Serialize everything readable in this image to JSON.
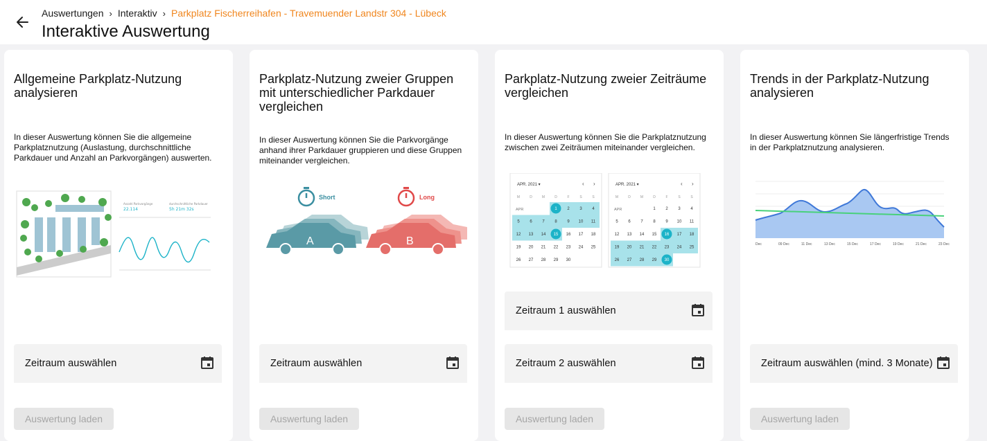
{
  "header": {
    "breadcrumb": [
      "Auswertungen",
      "Interaktiv",
      "Parkplatz Fischerreihafen - Travemuender Landstr 304 - Lübeck"
    ],
    "title": "Interaktive Auswertung"
  },
  "colors": {
    "accent": "#f0861e",
    "teal": "#1cb3c8",
    "car_a": "#5a9aa6",
    "car_b": "#e46e6a"
  },
  "cards": [
    {
      "title": "Allgemeine Parkplatz-Nutzung analysieren",
      "description": "In dieser Auswertung können Sie die allgemeine Parkplatznutzung (Auslastung, durchschnittliche Parkdauer und Anzahl an Parkvorgängen) auswerten.",
      "fields": [
        "Zeitraum auswählen"
      ],
      "button": "Auswertung laden",
      "illustration": {
        "stat1_label": "Anzahl Parkvorgänge",
        "stat1_value": "22.114",
        "stat2_label": "durchschnittliche Parkdauer",
        "stat2_value": "5h 21m 32s"
      }
    },
    {
      "title": "Parkplatz-Nutzung zweier Gruppen mit unterschiedlicher Parkdauer vergleichen",
      "description": "In dieser Auswertung können Sie die Parkvorgänge anhand ihrer Parkdauer gruppieren und diese Gruppen miteinander vergleichen.",
      "fields": [
        "Zeitraum auswählen"
      ],
      "button": "Auswertung laden",
      "illustration": {
        "short_label": "Short",
        "long_label": "Long",
        "car_a": "A",
        "car_b": "B"
      }
    },
    {
      "title": "Parkplatz-Nutzung zweier Zeiträume vergleichen",
      "description": "In dieser Auswertung können Sie die Parkplatznutzung zwischen zwei Zeiträumen miteinander vergleichen.",
      "fields": [
        "Zeitraum 1 auswählen",
        "Zeitraum 2 auswählen"
      ],
      "button": "Auswertung laden",
      "illustration": {
        "month": "APR. 2021",
        "month_short": "APR",
        "weekdays": [
          "M",
          "D",
          "M",
          "D",
          "F",
          "S",
          "S"
        ]
      }
    },
    {
      "title": "Trends in der Parkplatz-Nutzung analysieren",
      "description": "In dieser Auswertung können Sie längerfristige Trends in der Parkplatznutzung analysieren.",
      "fields": [
        "Zeitraum auswählen (mind. 3 Monate)"
      ],
      "button": "Auswertung laden",
      "illustration": {
        "x_labels": [
          "Dec",
          "09 Dec",
          "11 Dec",
          "13 Dec",
          "15 Dec",
          "17 Dec",
          "19 Dec",
          "21 Dec",
          "23 Dec"
        ]
      }
    }
  ]
}
